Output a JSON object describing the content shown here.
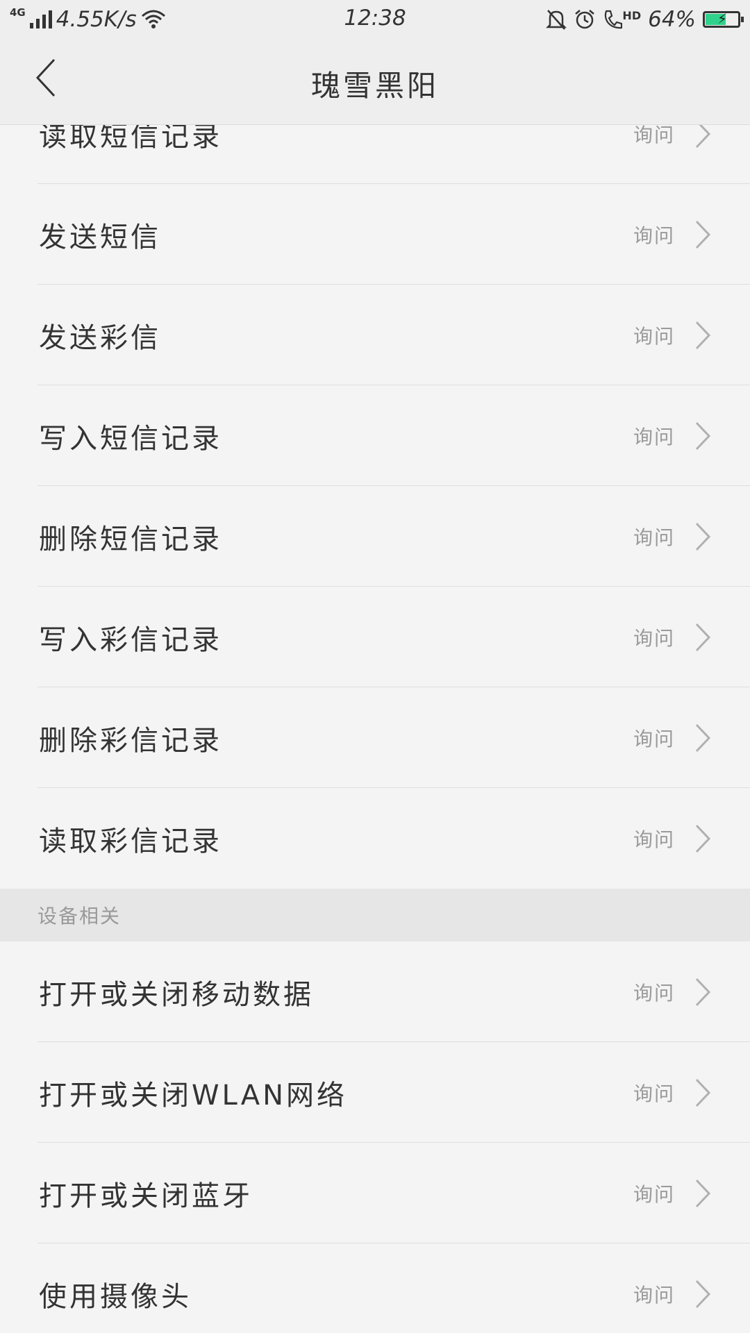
{
  "status_bar": {
    "network_type": "4G",
    "speed": "4.55K/s",
    "time": "12:38",
    "hd": "HD",
    "battery_percent": "64%",
    "battery_level": 0.64,
    "battery_color": "#2fd18b",
    "icons": [
      "signal-icon",
      "wifi-icon",
      "silent-bell-icon",
      "alarm-icon",
      "hd-call-icon",
      "battery-charging-icon"
    ]
  },
  "header": {
    "title": "瑰雪黑阳",
    "back_icon": "chevron-left-icon"
  },
  "sms_items": [
    {
      "label": "读取短信记录",
      "value": "询问"
    },
    {
      "label": "发送短信",
      "value": "询问"
    },
    {
      "label": "发送彩信",
      "value": "询问"
    },
    {
      "label": "写入短信记录",
      "value": "询问"
    },
    {
      "label": "删除短信记录",
      "value": "询问"
    },
    {
      "label": "写入彩信记录",
      "value": "询问"
    },
    {
      "label": "删除彩信记录",
      "value": "询问"
    },
    {
      "label": "读取彩信记录",
      "value": "询问"
    }
  ],
  "device_section": {
    "title": "设备相关",
    "items": [
      {
        "label": "打开或关闭移动数据",
        "value": "询问"
      },
      {
        "label": "打开或关闭WLAN网络",
        "value": "询问"
      },
      {
        "label": "打开或关闭蓝牙",
        "value": "询问"
      },
      {
        "label": "使用摄像头",
        "value": "询问"
      }
    ]
  }
}
